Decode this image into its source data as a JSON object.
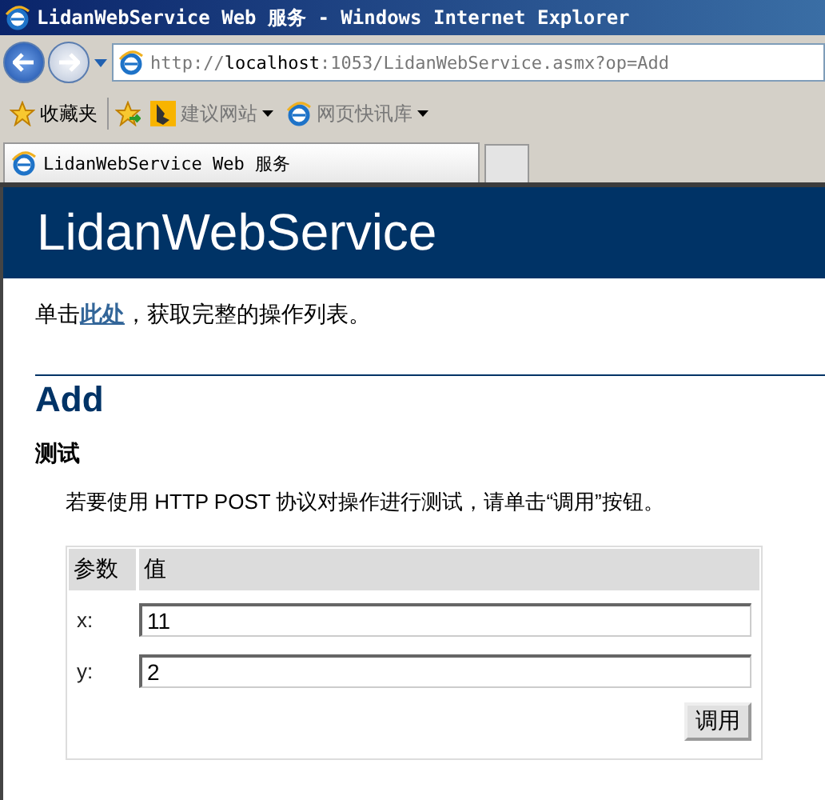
{
  "window": {
    "title": "LidanWebService Web 服务 - Windows Internet Explorer"
  },
  "address_bar": {
    "url_prefix": "http://",
    "url_host": "localhost",
    "url_rest": ":1053/LidanWebService.asmx?op=Add"
  },
  "favorites_bar": {
    "favorites": "收藏夹",
    "links": [
      {
        "label": "建议网站",
        "kind": "bing"
      },
      {
        "label": "网页快讯库",
        "kind": "ie"
      }
    ]
  },
  "tabs": [
    {
      "label": "LidanWebService Web 服务",
      "selected": true
    }
  ],
  "page": {
    "banner": "LidanWebService",
    "intro": "单击",
    "intro_link": "此处",
    "intro_rest": "，获取完整的操作列表。",
    "operation": "Add",
    "section": "测试",
    "description": "若要使用 HTTP POST 协议对操作进行测试，请单击“调用”按钮。",
    "table": {
      "columns": [
        "参数",
        "值"
      ],
      "rows": [
        {
          "name": "x:",
          "value": "11"
        },
        {
          "name": "y:",
          "value": "2"
        }
      ],
      "button": "调用"
    }
  }
}
